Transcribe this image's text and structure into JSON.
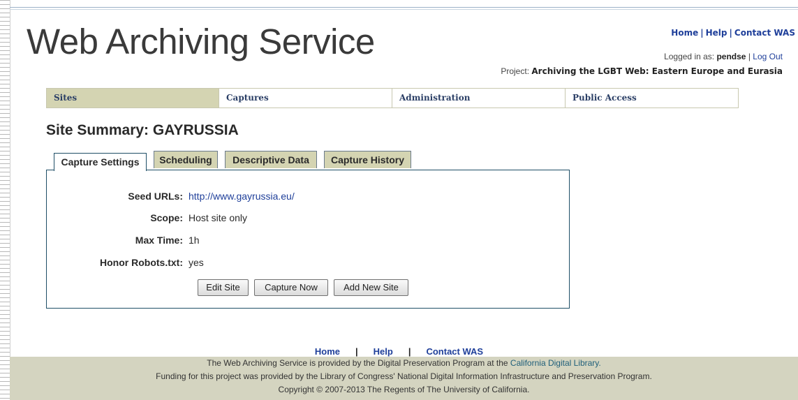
{
  "header": {
    "logo": "Web Archiving Service",
    "links": [
      "Home",
      "Help",
      "Contact WAS"
    ],
    "logged_in_prefix": "Logged in as:",
    "username": "pendse",
    "logout": "Log Out",
    "project_prefix": "Project:",
    "project_name": "Archiving the LGBT Web: Eastern Europe and Eurasia"
  },
  "nav": {
    "items": [
      "Sites",
      "Captures",
      "Administration",
      "Public Access"
    ],
    "active": "Sites"
  },
  "page": {
    "title": "Site Summary: GAYRUSSIA"
  },
  "tabs": {
    "items": [
      "Capture Settings",
      "Scheduling",
      "Descriptive Data",
      "Capture History"
    ],
    "active": "Capture Settings"
  },
  "settings": {
    "seed_label": "Seed URLs:",
    "seed_value": "http://www.gayrussia.eu/",
    "scope_label": "Scope:",
    "scope_value": "Host site only",
    "maxtime_label": "Max Time:",
    "maxtime_value": "1h",
    "robots_label": "Honor Robots.txt:",
    "robots_value": "yes"
  },
  "buttons": {
    "edit": "Edit Site",
    "capture": "Capture Now",
    "add": "Add New Site"
  },
  "footer": {
    "links": [
      "Home",
      "Help",
      "Contact WAS"
    ],
    "line1_prefix": "The Web Archiving Service is provided by the Digital Preservation Program at the",
    "line1_link": "California Digital Library.",
    "line2": "Funding for this project was provided by the Library of Congress' National Digital Information Infrastructure and Preservation Program.",
    "line3": "Copyright © 2007-2013 The Regents of The University of California."
  },
  "colors": {
    "link": "#1f3f9a",
    "nav_active": "#d4d4b2",
    "footer_bg": "#d4d4c0",
    "panel_border": "#1e4e66"
  }
}
